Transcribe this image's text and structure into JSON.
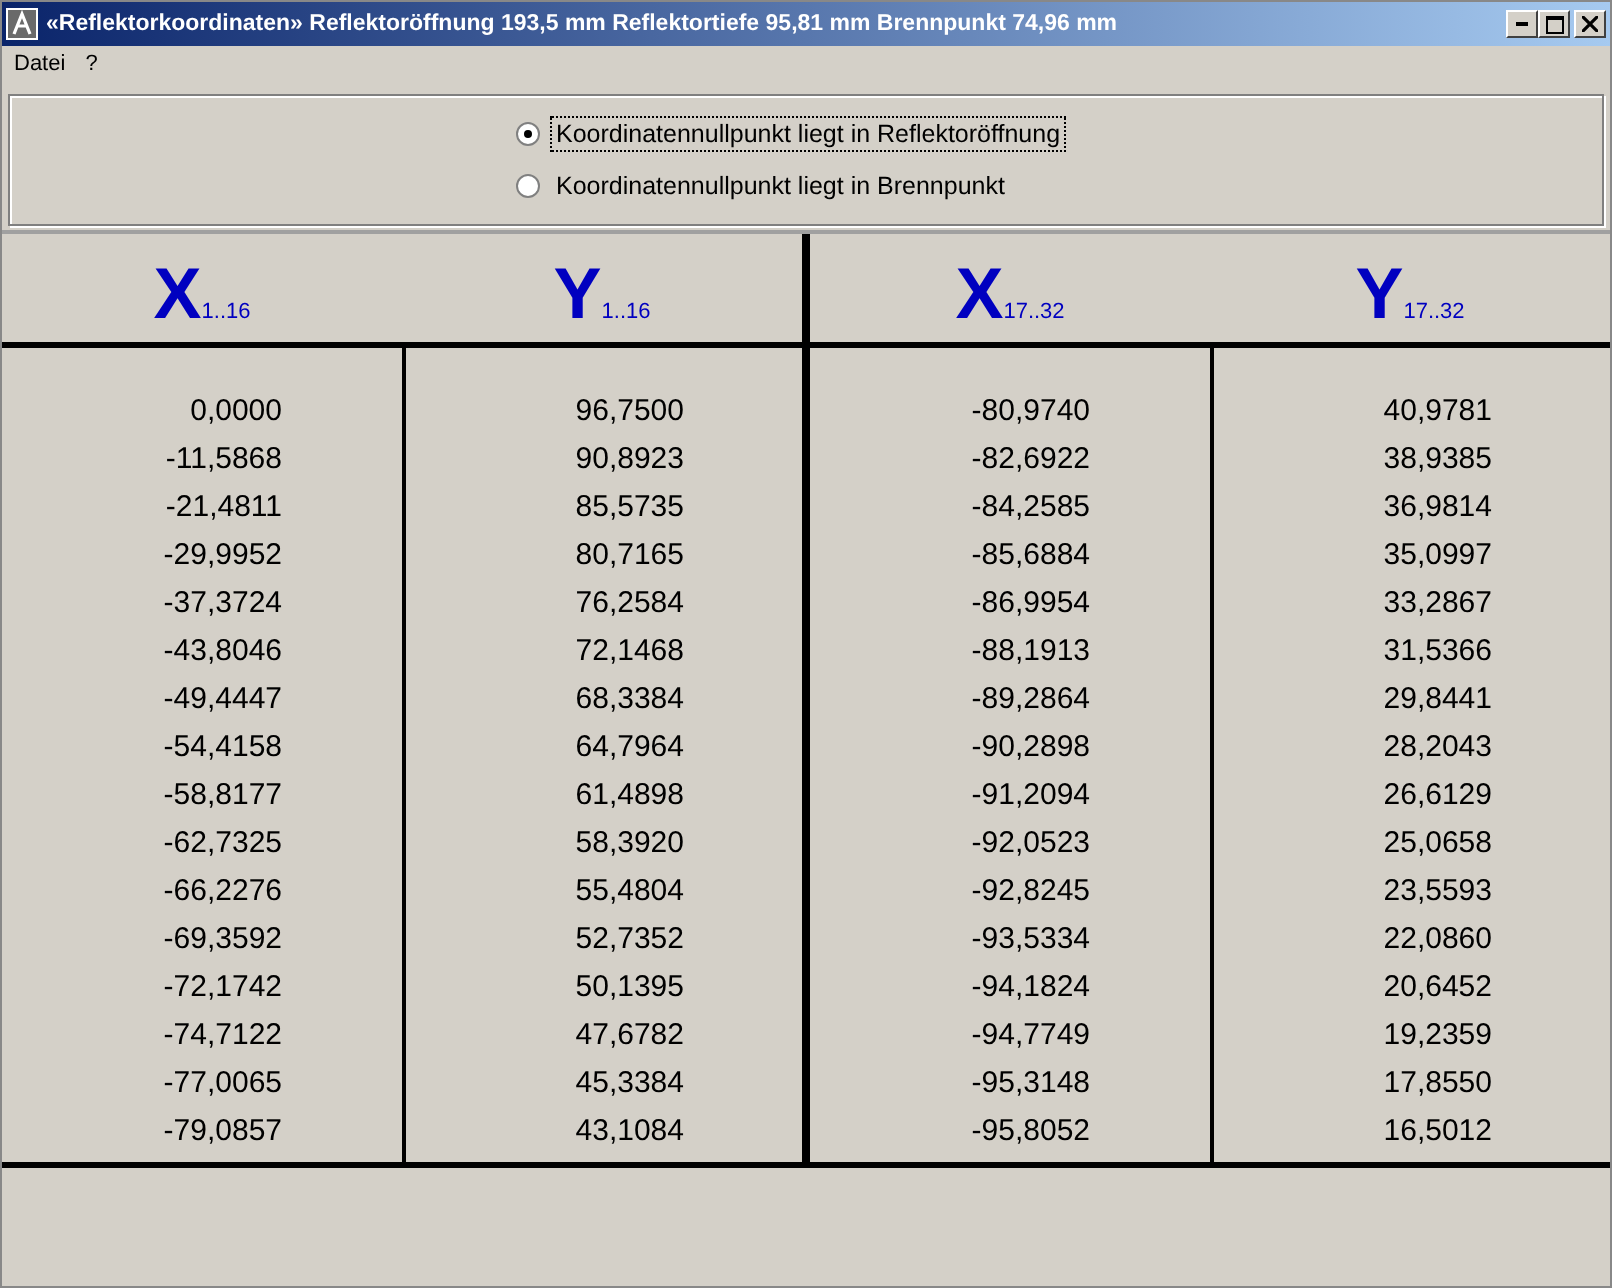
{
  "window": {
    "title": "«Reflektorkoordinaten» Reflektoröffnung 193,5 mm  Reflektortiefe 95,81 mm  Brennpunkt 74,96 mm"
  },
  "menu": [
    "Datei",
    "?"
  ],
  "origin_options": [
    {
      "label": "Koordinatennullpunkt liegt in Reflektoröffnung",
      "selected": true
    },
    {
      "label": "Koordinatennullpunkt liegt in Brennpunkt",
      "selected": false
    }
  ],
  "table": {
    "columns": [
      {
        "symbol": "X",
        "range": "1..16",
        "values": [
          "0,0000",
          "-11,5868",
          "-21,4811",
          "-29,9952",
          "-37,3724",
          "-43,8046",
          "-49,4447",
          "-54,4158",
          "-58,8177",
          "-62,7325",
          "-66,2276",
          "-69,3592",
          "-72,1742",
          "-74,7122",
          "-77,0065",
          "-79,0857"
        ]
      },
      {
        "symbol": "Y",
        "range": "1..16",
        "values": [
          "96,7500",
          "90,8923",
          "85,5735",
          "80,7165",
          "76,2584",
          "72,1468",
          "68,3384",
          "64,7964",
          "61,4898",
          "58,3920",
          "55,4804",
          "52,7352",
          "50,1395",
          "47,6782",
          "45,3384",
          "43,1084"
        ]
      },
      {
        "symbol": "X",
        "range": "17..32",
        "values": [
          "-80,9740",
          "-82,6922",
          "-84,2585",
          "-85,6884",
          "-86,9954",
          "-88,1913",
          "-89,2864",
          "-90,2898",
          "-91,2094",
          "-92,0523",
          "-92,8245",
          "-93,5334",
          "-94,1824",
          "-94,7749",
          "-95,3148",
          "-95,8052"
        ]
      },
      {
        "symbol": "Y",
        "range": "17..32",
        "values": [
          "40,9781",
          "38,9385",
          "36,9814",
          "35,0997",
          "33,2867",
          "31,5366",
          "29,8441",
          "28,2043",
          "26,6129",
          "25,0658",
          "23,5593",
          "22,0860",
          "20,6452",
          "19,2359",
          "17,8550",
          "16,5012"
        ]
      }
    ]
  }
}
